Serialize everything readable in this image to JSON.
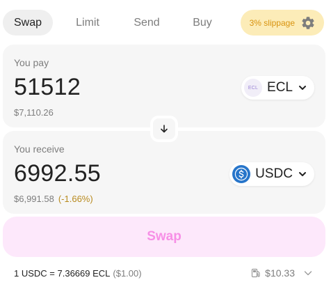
{
  "tabs": [
    {
      "label": "Swap",
      "active": true
    },
    {
      "label": "Limit",
      "active": false
    },
    {
      "label": "Send",
      "active": false
    },
    {
      "label": "Buy",
      "active": false
    }
  ],
  "slippage": {
    "label": "3% slippage",
    "icon": "gear-icon"
  },
  "pay": {
    "label": "You pay",
    "amount": "51512",
    "fiat": "$7,110.26",
    "token": {
      "symbol": "ECL",
      "logo_text": "ECL"
    }
  },
  "receive": {
    "label": "You receive",
    "amount": "6992.55",
    "fiat": "$6,991.58",
    "change": "(-1.66%)",
    "token": {
      "symbol": "USDC"
    }
  },
  "switch_icon": "arrow-down-icon",
  "action": {
    "label": "Swap"
  },
  "footer": {
    "rate": "1 USDC = 7.36669 ECL",
    "rate_usd": "($1.00)",
    "gas_fee": "$10.33",
    "gas_icon": "gas-pump-icon"
  },
  "colors": {
    "accent_pink": "#f78fe6",
    "swap_button_bg": "#fde8fb",
    "slippage_bg": "#fcecb8",
    "slippage_text": "#d8930f",
    "negative_change": "#b88a1e",
    "usdc_blue": "#2775ca"
  }
}
